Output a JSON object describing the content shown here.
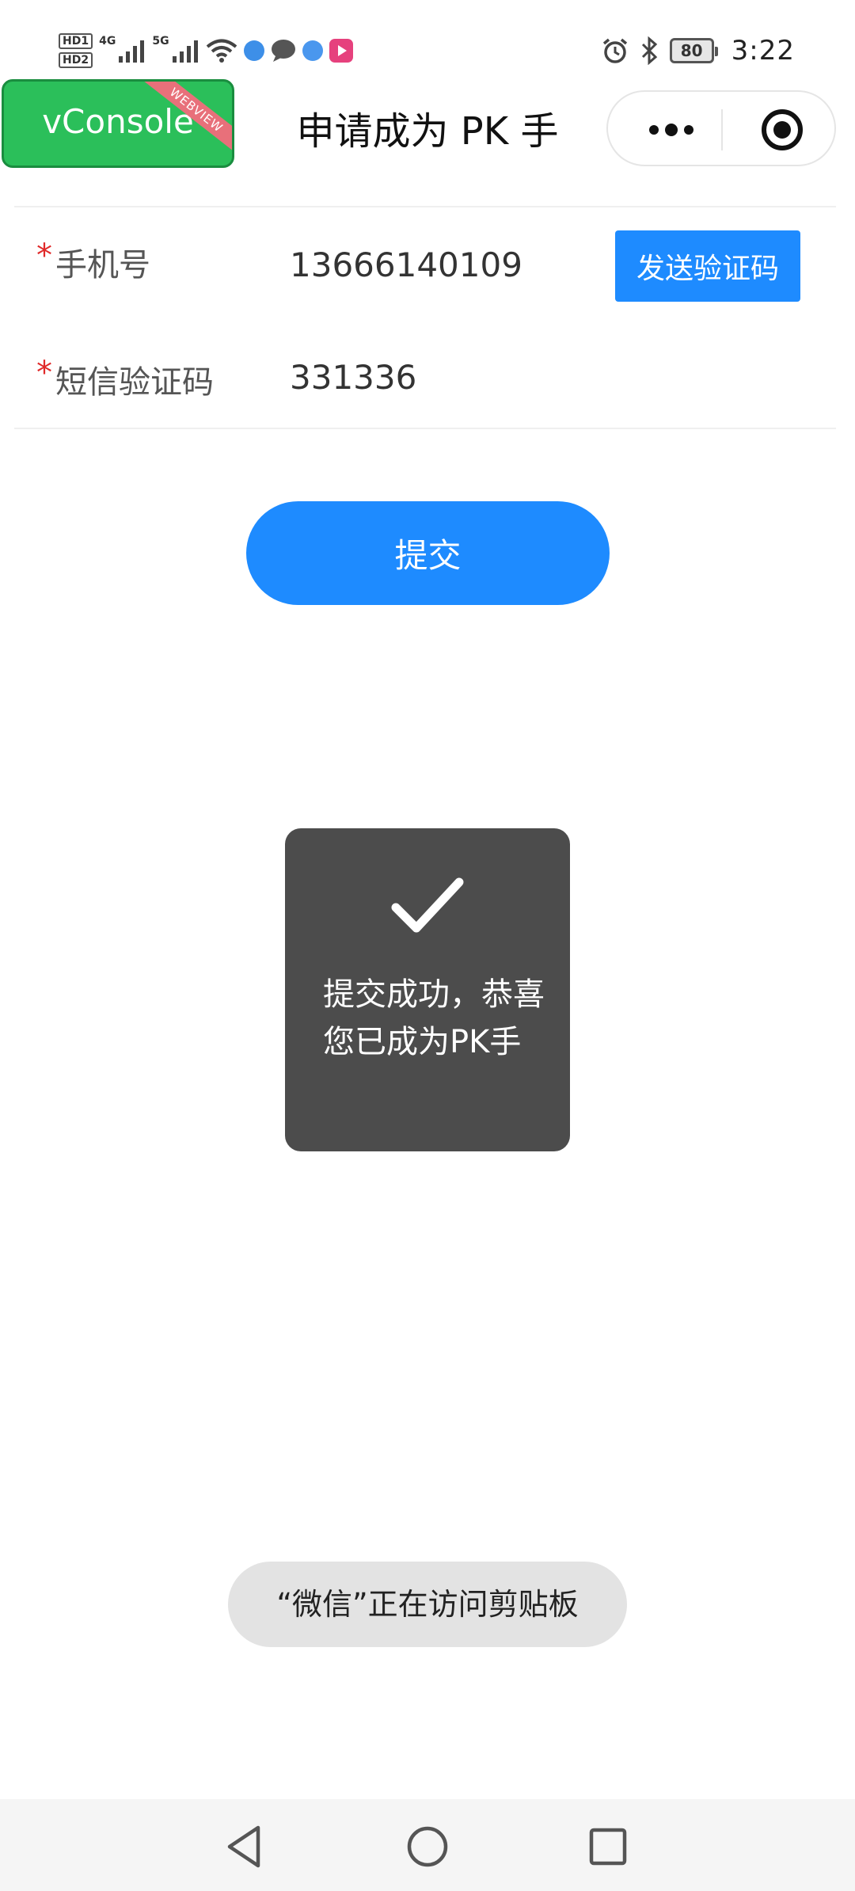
{
  "status_bar": {
    "hd1": "HD1",
    "hd2": "HD2",
    "net1": "4G",
    "net2": "5G",
    "battery": "80",
    "time": "3:22"
  },
  "title_bar": {
    "vconsole_label": "vConsole",
    "vconsole_ribbon": "WEBVIEW",
    "title": "申请成为 PK 手"
  },
  "form": {
    "phone": {
      "required_mark": "*",
      "label": "手机号",
      "value": "13666140109"
    },
    "send_code_label": "发送验证码",
    "sms": {
      "required_mark": "*",
      "label": "短信验证码",
      "value": "331336"
    },
    "submit_label": "提交"
  },
  "toast": {
    "message": "提交成功，恭喜您已成为PK手"
  },
  "clipboard_notice": "“微信”正在访问剪贴板",
  "colors": {
    "primary": "#1e8bff",
    "required": "#e02a2a",
    "vconsole_green": "#2bbf5a",
    "toast_bg": "#4c4c4c"
  }
}
